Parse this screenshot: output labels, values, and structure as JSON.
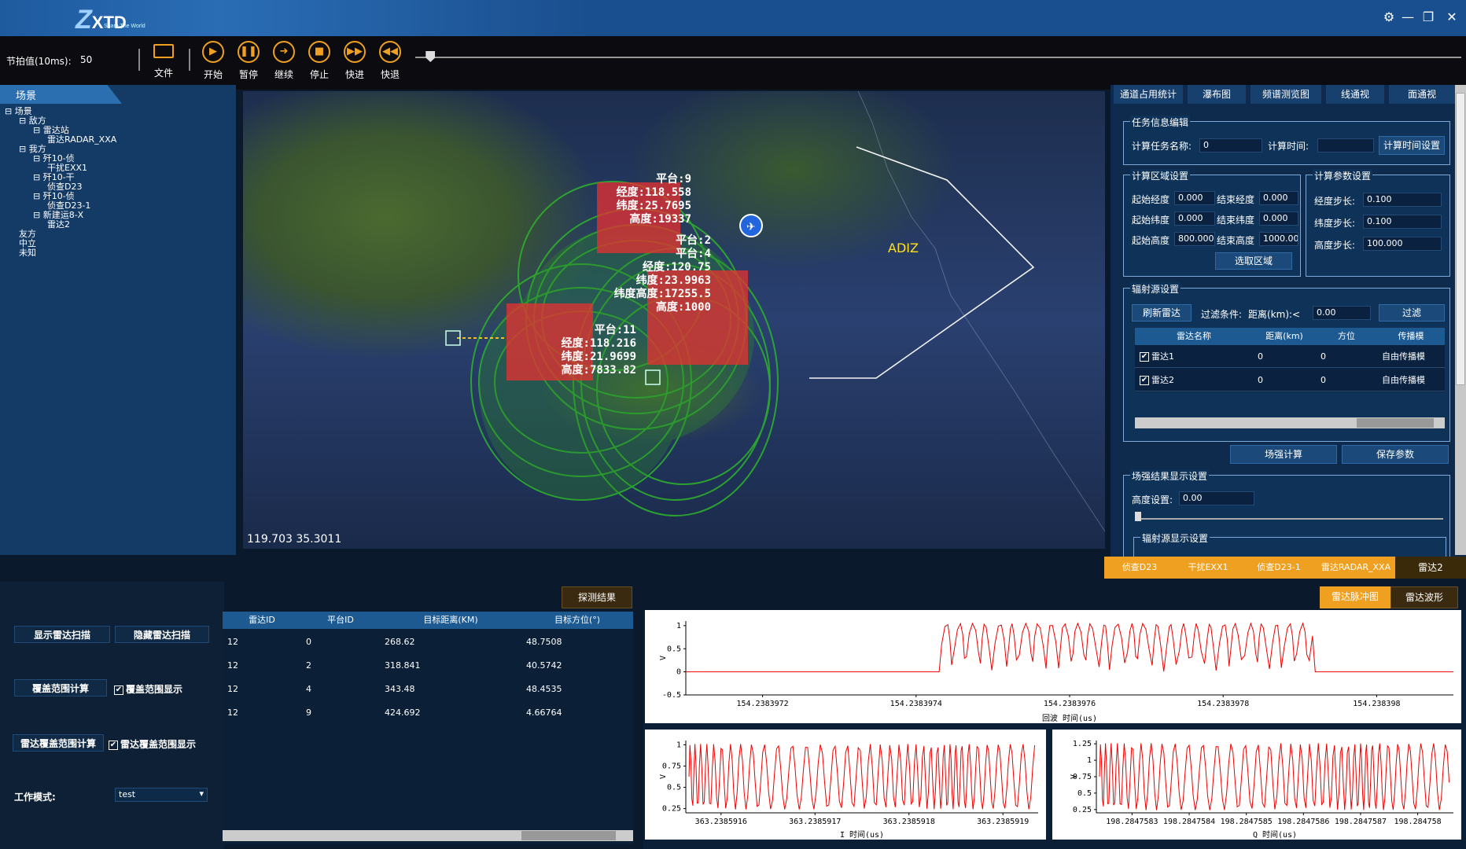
{
  "app": {
    "logo": "XTD",
    "logo_sub": "Share The World"
  },
  "window_controls": {
    "settings": "⚙",
    "minimize": "—",
    "restore": "❐",
    "close": "✕"
  },
  "toolbar": {
    "tempo_label": "节拍值(10ms):",
    "tempo_value": "50",
    "buttons": [
      {
        "label": "文件",
        "icon": "folder-icon"
      },
      {
        "label": "开始",
        "icon": "play-icon"
      },
      {
        "label": "暂停",
        "icon": "pause-icon"
      },
      {
        "label": "继续",
        "icon": "forward-arrow-icon"
      },
      {
        "label": "停止",
        "icon": "stop-icon"
      },
      {
        "label": "快进",
        "icon": "fast-forward-icon"
      },
      {
        "label": "快退",
        "icon": "rewind-icon"
      }
    ],
    "progress": 0.01
  },
  "scene": {
    "tab": "场景",
    "tree": [
      {
        "label": "场景",
        "level": 0,
        "box": "⊟"
      },
      {
        "label": "敌方",
        "level": 1,
        "box": "⊟"
      },
      {
        "label": "雷达站",
        "level": 2,
        "box": "⊟"
      },
      {
        "label": "雷达RADAR_XXA",
        "level": 3,
        "box": ""
      },
      {
        "label": "我方",
        "level": 1,
        "box": "⊟"
      },
      {
        "label": "歼10-侦",
        "level": 2,
        "box": "⊟"
      },
      {
        "label": "干扰EXX1",
        "level": 3,
        "box": ""
      },
      {
        "label": "歼10-干",
        "level": 2,
        "box": "⊟"
      },
      {
        "label": "侦查D23",
        "level": 3,
        "box": ""
      },
      {
        "label": "歼10-侦",
        "level": 2,
        "box": "⊟"
      },
      {
        "label": "侦查D23-1",
        "level": 3,
        "box": ""
      },
      {
        "label": "新建运8-X",
        "level": 2,
        "box": "⊟"
      },
      {
        "label": "雷达2",
        "level": 3,
        "box": ""
      },
      {
        "label": "友方",
        "level": 1,
        "box": ""
      },
      {
        "label": "中立",
        "level": 1,
        "box": ""
      },
      {
        "label": "未知",
        "level": 1,
        "box": ""
      }
    ]
  },
  "map": {
    "coords": "119.703  35.3011",
    "adiz": "ADIZ",
    "labels": [
      {
        "lines": [
          "平台:9",
          "经度:118.558",
          "纬度:25.7695",
          "高度:19337"
        ]
      },
      {
        "lines": [
          "平台:2",
          "平台:4",
          "经度:120.75",
          "纬度:23.9963",
          "纬度高度:17255.5",
          "高度:1000"
        ]
      },
      {
        "lines": [
          "平台:11",
          "经度:118.216",
          "纬度:21.9699",
          "高度:7833.82"
        ]
      }
    ]
  },
  "right_panel": {
    "tabs": [
      "通道占用统计",
      "瀑布图",
      "频谱测览图",
      "线通视",
      "面通视"
    ],
    "task": {
      "title": "任务信息编辑",
      "name_label": "计算任务名称:",
      "name_value": "0",
      "time_label": "计算时间:",
      "time_value": "",
      "time_btn": "计算时间设置"
    },
    "region": {
      "title": "计算区域设置",
      "rows": [
        {
          "l1": "起始经度",
          "v1": "0.000",
          "l2": "结束经度",
          "v2": "0.000"
        },
        {
          "l1": "起始纬度",
          "v1": "0.000",
          "l2": "结束纬度",
          "v2": "0.000"
        },
        {
          "l1": "起始高度",
          "v1": "800.000",
          "l2": "结束高度",
          "v2": "1000.00"
        }
      ],
      "select_btn": "选取区域"
    },
    "params": {
      "title": "计算参数设置",
      "rows": [
        {
          "l": "经度步长:",
          "v": "0.100"
        },
        {
          "l": "纬度步长:",
          "v": "0.100"
        },
        {
          "l": "高度步长:",
          "v": "100.000"
        }
      ]
    },
    "radiation": {
      "title": "辐射源设置",
      "refresh_btn": "刷新雷达",
      "filter_label": "过滤条件:",
      "distance_label": "距离(km):<",
      "distance_value": "0.00",
      "filter_btn": "过滤",
      "headers": [
        "雷达名称",
        "距离(km)",
        "方位",
        "传播模"
      ],
      "rows": [
        {
          "name": "雷达1",
          "dist": "0",
          "az": "0",
          "prop": "自由传播模"
        },
        {
          "name": "雷达2",
          "dist": "0",
          "az": "0",
          "prop": "自由传播模"
        }
      ]
    },
    "calc_btn": "场强计算",
    "save_btn": "保存参数",
    "field_display": {
      "title": "场强结果显示设置",
      "height_label": "高度设置:",
      "height_value": "0.00"
    },
    "rad_display": {
      "title": "辐射源显示设置"
    }
  },
  "device_tabs": [
    "侦查D23",
    "干扰EXX1",
    "侦查D23-1",
    "雷达RADAR_XXA",
    "雷达2"
  ],
  "bottom_left": {
    "show_scan": "显示雷达扫描",
    "hide_scan": "隐藏雷达扫描",
    "coverage_calc": "覆盖范围计算",
    "coverage_show": "覆盖范围显示",
    "radar_coverage_calc": "雷达覆盖范围计算",
    "radar_coverage_show": "雷达覆盖范围显示",
    "mode_label": "工作模式:",
    "mode_value": "test"
  },
  "results": {
    "tab": "探测结果",
    "headers": [
      "雷达ID",
      "平台ID",
      "目标距离(KM)",
      "目标方位(°)"
    ],
    "rows": [
      [
        "12",
        "0",
        "268.62",
        "48.7508"
      ],
      [
        "12",
        "2",
        "318.841",
        "40.5742"
      ],
      [
        "12",
        "4",
        "343.48",
        "48.4535"
      ],
      [
        "12",
        "9",
        "424.692",
        "4.66764"
      ]
    ]
  },
  "charts_tabs": [
    "雷达脉冲图",
    "雷达波形"
  ],
  "chart_data": [
    {
      "type": "line",
      "xlabel": "回波  时间(us)",
      "ylabel": "V",
      "x_ticks": [
        "154.2383972",
        "154.2383974",
        "154.2383976",
        "154.2383978",
        "154.238398"
      ],
      "y_ticks": [
        "1",
        "0.5",
        "0",
        "-0.5"
      ],
      "ylim": [
        -0.5,
        1.1
      ],
      "color": "#ee0000",
      "series": [
        {
          "pulse_start": 0.33,
          "pulse_end": 0.82
        }
      ]
    },
    {
      "type": "line",
      "xlabel": "I  时间(us)",
      "ylabel": "V",
      "x_ticks": [
        "363.2385916",
        "363.2385917",
        "363.2385918",
        "363.2385919"
      ],
      "y_ticks": [
        "1",
        "0.75",
        "0.5",
        "0.25"
      ],
      "ylim": [
        0.2,
        1.05
      ],
      "color": "#ee0000"
    },
    {
      "type": "line",
      "xlabel": "Q  时间(us)",
      "ylabel": "V",
      "x_ticks": [
        "198.2847583",
        "198.2847584",
        "198.2847585",
        "198.2847586",
        "198.2847587",
        "198.284758"
      ],
      "y_ticks": [
        "1.25",
        "1",
        "0.75",
        "0.5",
        "0.25"
      ],
      "ylim": [
        0.2,
        1.3
      ],
      "color": "#ee0000"
    }
  ]
}
